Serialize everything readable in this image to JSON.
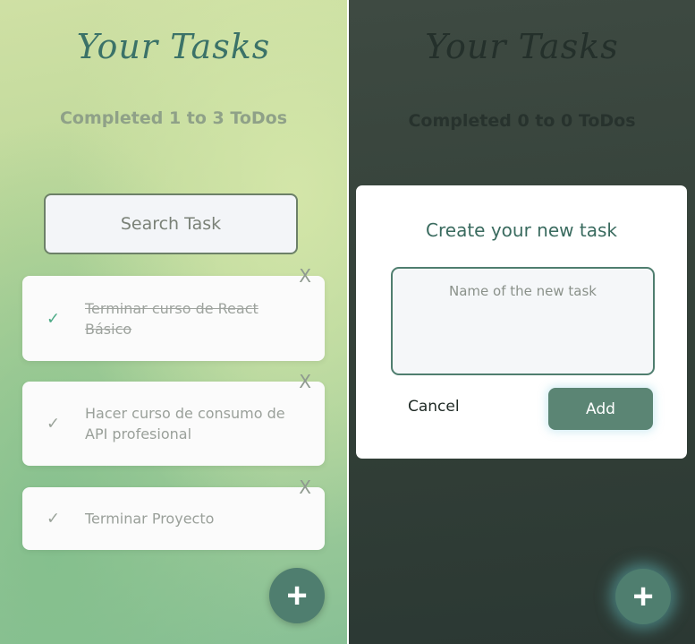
{
  "left_screen": {
    "title": "Your Tasks",
    "counter": "Completed 1 to 3 ToDos",
    "search": {
      "placeholder": "Search Task",
      "value": ""
    },
    "todos": [
      {
        "text": "Terminar curso de React Básico",
        "completed": true,
        "check_icon": "✓",
        "delete_icon": "X"
      },
      {
        "text": "Hacer curso de consumo de API profesional",
        "completed": false,
        "check_icon": "✓",
        "delete_icon": "X"
      },
      {
        "text": "Terminar Proyecto",
        "completed": false,
        "check_icon": "✓",
        "delete_icon": "X"
      }
    ],
    "fab_icon": "+"
  },
  "right_screen": {
    "title": "Your Tasks",
    "counter": "Completed 0 to 0 ToDos",
    "modal": {
      "title": "Create your new task",
      "input_placeholder": "Name of the new task",
      "input_value": "",
      "cancel_label": "Cancel",
      "add_label": "Add"
    },
    "fab_icon": "+"
  },
  "colors": {
    "accent": "#4f7e6f",
    "title_green": "#3b7268",
    "check_done": "#4caa86",
    "overlay_dark": "#334038"
  }
}
